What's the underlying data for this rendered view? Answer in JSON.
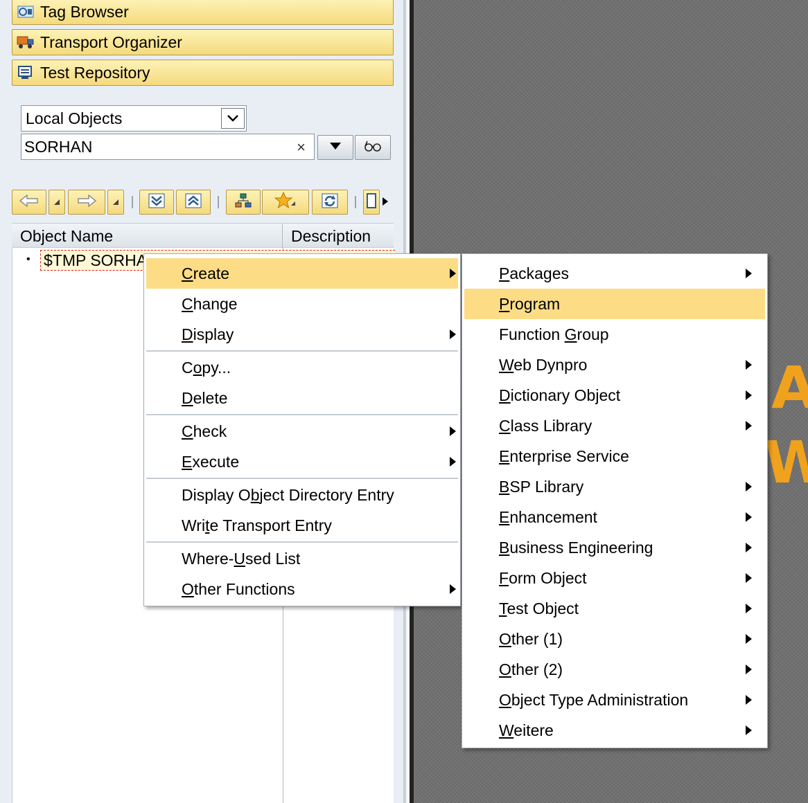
{
  "tools": [
    {
      "label": "Tag Browser",
      "icon": "tag-browser-icon"
    },
    {
      "label": "Transport Organizer",
      "icon": "transport-truck-icon"
    },
    {
      "label": "Test Repository",
      "icon": "test-repository-icon"
    }
  ],
  "selector": {
    "value": "Local Objects"
  },
  "object_input": {
    "value": "SORHAN",
    "clear": "×"
  },
  "tree": {
    "columns": [
      "Object Name",
      "Description"
    ],
    "node": "$TMP SORHAN",
    "bullet": "•"
  },
  "context_menu": {
    "items": [
      {
        "before": "",
        "key": "C",
        "after": "reate",
        "submenu": true,
        "highlighted": true
      },
      {
        "before": "",
        "key": "C",
        "after": "hange",
        "submenu": false
      },
      {
        "before": "",
        "key": "D",
        "after": "isplay",
        "submenu": true
      },
      {
        "before": "C",
        "key": "o",
        "after": "py...",
        "submenu": false
      },
      {
        "before": "",
        "key": "D",
        "after": "elete",
        "submenu": false
      },
      {
        "before": "",
        "key": "C",
        "after": "heck",
        "submenu": true
      },
      {
        "before": "",
        "key": "E",
        "after": "xecute",
        "submenu": true
      },
      {
        "before": "Display O",
        "key": "b",
        "after": "ject Directory Entry",
        "submenu": false
      },
      {
        "before": "Wri",
        "key": "t",
        "after": "e Transport Entry",
        "submenu": false
      },
      {
        "before": "Where-",
        "key": "U",
        "after": "sed List",
        "submenu": false
      },
      {
        "before": "",
        "key": "O",
        "after": "ther Functions",
        "submenu": true
      }
    ]
  },
  "create_submenu": {
    "items": [
      {
        "before": "",
        "key": "P",
        "after": "ackages",
        "submenu": true
      },
      {
        "before": "",
        "key": "P",
        "after": "rogram",
        "submenu": false,
        "highlighted": true
      },
      {
        "before": "Function ",
        "key": "G",
        "after": "roup",
        "submenu": false
      },
      {
        "before": "",
        "key": "W",
        "after": "eb Dynpro",
        "submenu": true
      },
      {
        "before": "",
        "key": "D",
        "after": "ictionary Object",
        "submenu": true
      },
      {
        "before": "",
        "key": "C",
        "after": "lass Library",
        "submenu": true
      },
      {
        "before": "",
        "key": "E",
        "after": "nterprise Service",
        "submenu": false
      },
      {
        "before": "",
        "key": "B",
        "after": "SP Library",
        "submenu": true
      },
      {
        "before": "",
        "key": "E",
        "after": "nhancement",
        "submenu": true
      },
      {
        "before": "",
        "key": "B",
        "after": "usiness Engineering",
        "submenu": true
      },
      {
        "before": "",
        "key": "F",
        "after": "orm Object",
        "submenu": true
      },
      {
        "before": "",
        "key": "T",
        "after": "est Object",
        "submenu": true
      },
      {
        "before": "",
        "key": "O",
        "after": "ther (1)",
        "submenu": true
      },
      {
        "before": "",
        "key": "O",
        "after": "ther (2)",
        "submenu": true
      },
      {
        "before": "",
        "key": "O",
        "after": "bject Type Administration",
        "submenu": true
      },
      {
        "before": "",
        "key": "W",
        "after": "eitere",
        "submenu": true
      }
    ]
  },
  "background_letters": [
    "A",
    "W"
  ],
  "colors": {
    "menu_highlight": "#fddc86",
    "tool_button": "#f5da7d",
    "orange_text": "#f0a21c"
  }
}
